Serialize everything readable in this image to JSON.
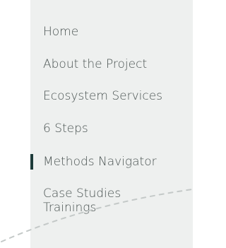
{
  "nav": {
    "items": [
      {
        "label": "Home"
      },
      {
        "label": "About the Project"
      },
      {
        "label": "Ecosystem Services"
      },
      {
        "label": "6 Steps"
      },
      {
        "label": "Methods Navigator",
        "active": true
      },
      {
        "label": "Case Studies"
      },
      {
        "label": "Trainings"
      }
    ]
  },
  "colors": {
    "panel_background": "#eef0ef",
    "text": "#4a5352",
    "active_marker": "#1d3b3a",
    "dashed_line": "#c4c9c8"
  }
}
